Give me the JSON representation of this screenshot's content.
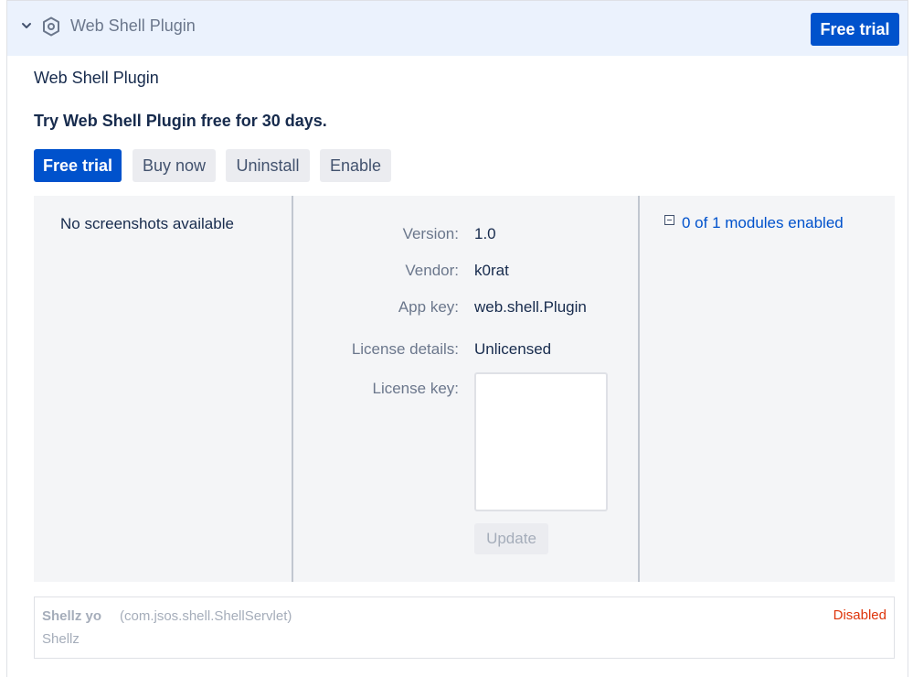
{
  "header": {
    "title": "Web Shell Plugin",
    "free_trial_label": "Free trial"
  },
  "plugin": {
    "name": "Web Shell Plugin",
    "trial_message": "Try Web Shell Plugin free for 30 days."
  },
  "actions": {
    "free_trial": "Free trial",
    "buy_now": "Buy now",
    "uninstall": "Uninstall",
    "enable": "Enable"
  },
  "screenshots": {
    "empty_text": "No screenshots available"
  },
  "details": {
    "version_label": "Version:",
    "version": "1.0",
    "vendor_label": "Vendor:",
    "vendor": "k0rat",
    "app_key_label": "App key:",
    "app_key": "web.shell.Plugin",
    "license_details_label": "License details:",
    "license_details": "Unlicensed",
    "license_key_label": "License key:",
    "license_key_value": "",
    "update_label": "Update"
  },
  "modules": {
    "summary": "0 of 1 modules enabled",
    "items": [
      {
        "name": "Shellz yo",
        "key": "(com.jsos.shell.ShellServlet)",
        "description": "Shellz",
        "status": "Disabled"
      }
    ]
  },
  "colors": {
    "primary": "#0052cc",
    "header_bg": "#ebf2fd",
    "panel_bg": "#f4f5f7",
    "disabled_status": "#de350b"
  },
  "icons": {
    "collapse": "chevron-down-icon",
    "plugin": "hexagon-plugin-icon",
    "modules_toggle": "collapse-minus-icon"
  }
}
